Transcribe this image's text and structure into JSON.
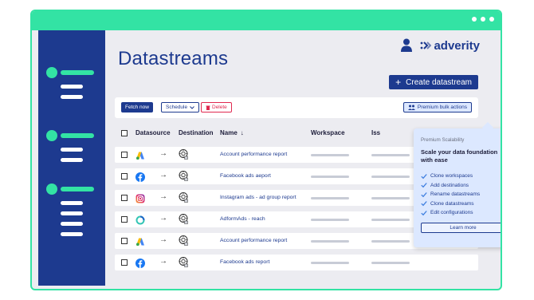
{
  "window": {
    "dot_count": 3
  },
  "header": {
    "title": "Datastreams",
    "brand": "adverity",
    "create_button": "Create datastream",
    "create_icon": "plus"
  },
  "toolbar": {
    "fetch_label": "Fetch now",
    "schedule_label": "Schedule",
    "delete_label": "Delete",
    "premium_label": "Premium bulk actions"
  },
  "table": {
    "columns": {
      "datasource": "Datasource",
      "destination": "Destination",
      "name": "Name",
      "workspace": "Workspace",
      "issues": "Iss"
    },
    "rows": [
      {
        "source": "google-ads-icon",
        "name": "Account performance report"
      },
      {
        "source": "facebook-icon",
        "name": "Facebook ads aeport"
      },
      {
        "source": "instagram-icon",
        "name": "Instagram ads - ad group report"
      },
      {
        "source": "adform-icon",
        "name": "AdformAds - reach"
      },
      {
        "source": "google-ads-icon",
        "name": "Account performance report"
      },
      {
        "source": "facebook-icon",
        "name": "Facebook ads report"
      }
    ]
  },
  "popup": {
    "eyebrow": "Premium Scalability",
    "heading": "Scale your data foundation with ease",
    "items": [
      "Clone workspaces",
      "Add destinations",
      "Rename datastreams",
      "Clone datastreams",
      "Edit configurations"
    ],
    "learn_more": "Learn more"
  },
  "colors": {
    "accent": "#33e3a4",
    "brand_blue": "#1d3a8f",
    "danger": "#e0284f",
    "popup_bg": "#dce8ff"
  }
}
